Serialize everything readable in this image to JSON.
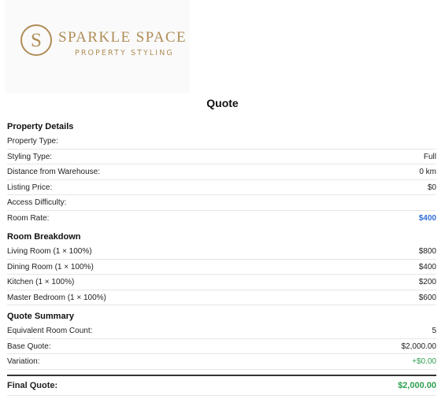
{
  "logo": {
    "monogram": "S",
    "brand": "SPARKLE SPACE",
    "tagline": "PROPERTY STYLING"
  },
  "heading": "Quote",
  "property_details": {
    "title": "Property Details",
    "rows": [
      {
        "label": "Property Type:",
        "value": ""
      },
      {
        "label": "Styling Type:",
        "value": "Full"
      },
      {
        "label": "Distance from Warehouse:",
        "value": "0 km"
      },
      {
        "label": "Listing Price:",
        "value": "$0"
      },
      {
        "label": "Access Difficulty:",
        "value": ""
      },
      {
        "label": "Room Rate:",
        "value": "$400"
      }
    ]
  },
  "room_breakdown": {
    "title": "Room Breakdown",
    "rows": [
      {
        "label": "Living Room (1 × 100%)",
        "value": "$800"
      },
      {
        "label": "Dining Room (1 × 100%)",
        "value": "$400"
      },
      {
        "label": "Kitchen (1 × 100%)",
        "value": "$200"
      },
      {
        "label": "Master Bedroom (1 × 100%)",
        "value": "$600"
      }
    ]
  },
  "quote_summary": {
    "title": "Quote Summary",
    "rows": [
      {
        "label": "Equivalent Room Count:",
        "value": "5"
      },
      {
        "label": "Base Quote:",
        "value": "$2,000.00"
      },
      {
        "label": "Variation:",
        "value": "+$0.00"
      }
    ]
  },
  "final": {
    "label": "Final Quote:",
    "value": "$2,000.00"
  },
  "colors": {
    "brand_gold": "#b08d57",
    "accent_blue": "#2f6fd6",
    "positive_green": "#2e9e4f"
  }
}
